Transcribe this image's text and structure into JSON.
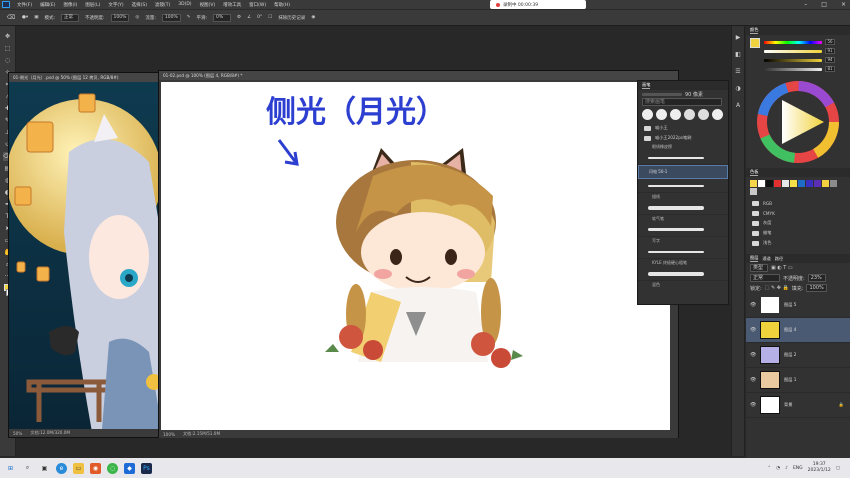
{
  "menubar": {
    "items": [
      "文件(F)",
      "编辑(E)",
      "图像(I)",
      "图层(L)",
      "文字(Y)",
      "选择(S)",
      "滤镜(T)",
      "3D(D)",
      "视图(V)",
      "增效工具",
      "窗口(W)",
      "帮助(H)"
    ],
    "recording": "录制中 00:00:39"
  },
  "options": {
    "mode_label": "模式:",
    "mode_value": "正常",
    "opacity_label": "不透明度:",
    "opacity_value": "100%",
    "flow_label": "流量:",
    "flow_value": "100%",
    "smooth_label": "平滑:",
    "smooth_value": "0%",
    "angle_value": "0°",
    "erase_history": "抹除历史记录"
  },
  "doc1": {
    "tab": "01-侧光（月光）.psd @ 50% (图层 12 拷贝, RGB/8#)",
    "zoom": "50%",
    "info": "文档:12.0M/320.0M"
  },
  "doc2": {
    "tab": "01-02.psd @ 100% (图层 4, RGB/8#) *",
    "zoom": "100%",
    "info": "文档:2.15M/51.0M",
    "canvas_title": "侧光（月光）"
  },
  "brush_panel": {
    "title": "画笔",
    "size_value": "90 像素",
    "search_placeholder": "搜索画笔",
    "group_main": "喵小王",
    "group_sub": "喵小王2022ps笔刷",
    "brushes": [
      "眼线橡皮擦",
      "闪电 50-1",
      "描线",
      "软气笔",
      "写字",
      "KYLE 终极硬心粗笔",
      "混色"
    ]
  },
  "color_panel": {
    "title": "颜色",
    "values": [
      "56",
      "91",
      "94",
      "81"
    ]
  },
  "swatches": {
    "title": "色板",
    "colors": [
      "#f5d54a",
      "#ffffff",
      "#111111",
      "#e03030",
      "#e7e7e7",
      "#f6e04a",
      "#1f6bc8",
      "#3a2ec0",
      "#5b2fb5",
      "#f3d040",
      "#8c8c8c",
      "#c9c9c9"
    ],
    "folders": [
      "RGB",
      "CMYK",
      "灰度",
      "蜡笔",
      "浅色"
    ]
  },
  "layers": {
    "tabs": [
      "图层",
      "通道",
      "路径"
    ],
    "filter_label": "类型",
    "blend_mode": "正常",
    "opacity_label": "不透明度:",
    "opacity_value": "23%",
    "lock_label": "锁定:",
    "fill_label": "填充:",
    "fill_value": "100%",
    "items": [
      {
        "name": "图层 5"
      },
      {
        "name": "图层 4"
      },
      {
        "name": "图层 2"
      },
      {
        "name": "图层 1"
      },
      {
        "name": "背景"
      }
    ]
  },
  "taskbar": {
    "lang": "ENG",
    "time": "19:37",
    "date": "2023/1/12"
  }
}
